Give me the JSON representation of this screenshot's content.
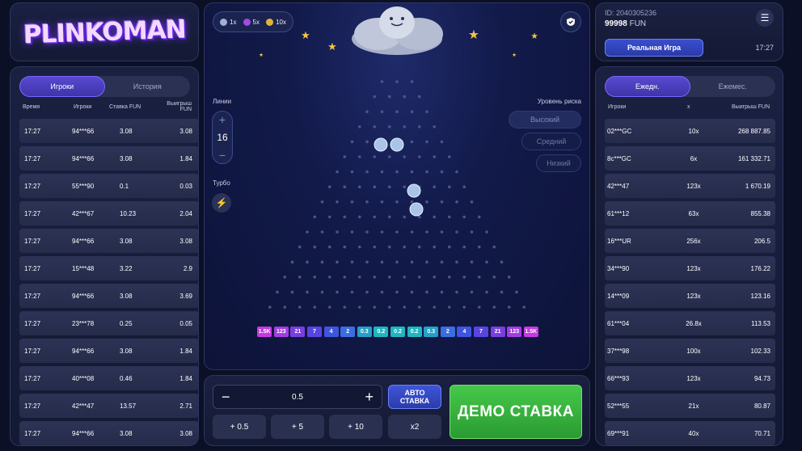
{
  "logo": {
    "text": "PLINKOMAN"
  },
  "left": {
    "tabs": [
      {
        "label": "Игроки",
        "active": true
      },
      {
        "label": "История",
        "active": false
      }
    ],
    "headers": {
      "time": "Время",
      "player": "Игроки",
      "bet": "Ставка FUN",
      "win": "Выигрыш FUN"
    },
    "rows": [
      {
        "time": "17:27",
        "player": "94***66",
        "bet": "3.08",
        "win": "3.08"
      },
      {
        "time": "17:27",
        "player": "94***66",
        "bet": "3.08",
        "win": "1.84"
      },
      {
        "time": "17:27",
        "player": "55***90",
        "bet": "0.1",
        "win": "0.03"
      },
      {
        "time": "17:27",
        "player": "42***67",
        "bet": "10.23",
        "win": "2.04"
      },
      {
        "time": "17:27",
        "player": "94***66",
        "bet": "3.08",
        "win": "3.08"
      },
      {
        "time": "17:27",
        "player": "15***48",
        "bet": "3.22",
        "win": "2.9"
      },
      {
        "time": "17:27",
        "player": "94***66",
        "bet": "3.08",
        "win": "3.69"
      },
      {
        "time": "17:27",
        "player": "23***78",
        "bet": "0.25",
        "win": "0.05"
      },
      {
        "time": "17:27",
        "player": "94***66",
        "bet": "3.08",
        "win": "1.84"
      },
      {
        "time": "17:27",
        "player": "40***08",
        "bet": "0.46",
        "win": "1.84"
      },
      {
        "time": "17:27",
        "player": "42***47",
        "bet": "13.57",
        "win": "2.71"
      },
      {
        "time": "17:27",
        "player": "94***66",
        "bet": "3.08",
        "win": "3.08"
      }
    ]
  },
  "game": {
    "chips": [
      {
        "label": "1x",
        "color": "#9fb0d8"
      },
      {
        "label": "5x",
        "color": "#a24be0"
      },
      {
        "label": "10x",
        "color": "#e0b43a"
      }
    ],
    "lines_label": "Линии",
    "lines_value": "16",
    "turbo_label": "Турбо",
    "risk_label": "Уровень риска",
    "risk_options": [
      {
        "label": "Высокий",
        "active": true
      },
      {
        "label": "Средний",
        "active": false
      },
      {
        "label": "Низкий",
        "active": false
      }
    ],
    "multipliers": [
      "1.5K",
      "123",
      "21",
      "7",
      "4",
      "2",
      "0.3",
      "0.2",
      "0.2",
      "0.2",
      "0.3",
      "2",
      "4",
      "7",
      "21",
      "123",
      "1.5K"
    ],
    "multiplier_colors": [
      "#c43adf",
      "#a33de0",
      "#7a3ee0",
      "#5a44e0",
      "#3f55e0",
      "#3a6ee0",
      "#26a0c8",
      "#1fb6c0",
      "#1fb6c0",
      "#1fb6c0",
      "#26a0c8",
      "#3a6ee0",
      "#3f55e0",
      "#5a44e0",
      "#7a3ee0",
      "#a33de0",
      "#c43adf"
    ]
  },
  "bet": {
    "value": "0.5",
    "minus": "−",
    "plus": "+",
    "auto_line1": "АВТО",
    "auto_line2": "СТАВКА",
    "quick": [
      "+ 0.5",
      "+ 5",
      "+ 10",
      "x2"
    ],
    "demo_label": "ДЕМО СТАВКА"
  },
  "account": {
    "id": "ID: 2040305236",
    "balance": "99998",
    "currency": "FUN",
    "mode_button": "Реальная Игра",
    "clock": "17:27"
  },
  "right": {
    "tabs": [
      {
        "label": "Ежедн.",
        "active": true
      },
      {
        "label": "Ежемес.",
        "active": false
      }
    ],
    "headers": {
      "player": "Игроки",
      "mult": "x",
      "win": "Выигрыш FUN"
    },
    "rows": [
      {
        "player": "02***GC",
        "mult": "10x",
        "win": "268 887.85"
      },
      {
        "player": "8c***GC",
        "mult": "6x",
        "win": "161 332.71"
      },
      {
        "player": "42***47",
        "mult": "123x",
        "win": "1 670.19"
      },
      {
        "player": "61***12",
        "mult": "63x",
        "win": "855.38"
      },
      {
        "player": "16***UR",
        "mult": "256x",
        "win": "206.5"
      },
      {
        "player": "34***90",
        "mult": "123x",
        "win": "176.22"
      },
      {
        "player": "14***09",
        "mult": "123x",
        "win": "123.16"
      },
      {
        "player": "61***04",
        "mult": "26.8x",
        "win": "113.53"
      },
      {
        "player": "37***98",
        "mult": "100x",
        "win": "102.33"
      },
      {
        "player": "66***93",
        "mult": "123x",
        "win": "94.73"
      },
      {
        "player": "52***55",
        "mult": "21x",
        "win": "80.87"
      },
      {
        "player": "69***91",
        "mult": "40x",
        "win": "70.71"
      }
    ]
  }
}
